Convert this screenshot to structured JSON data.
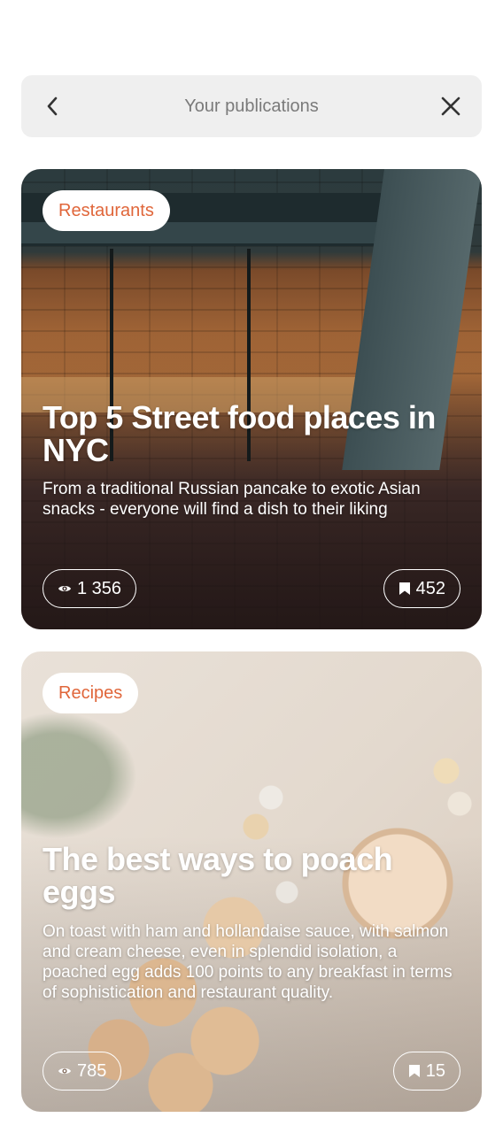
{
  "header": {
    "title": "Your publications",
    "back_icon": "chevron-left-icon",
    "close_icon": "close-icon"
  },
  "colors": {
    "accent": "#e0663a",
    "header_bg": "#efefef",
    "header_text": "#7a7a7a"
  },
  "publications": [
    {
      "category": "Restaurants",
      "title": "Top 5 Street food places in NYC",
      "description": "From a traditional Russian pancake to exotic Asian snacks - everyone will find a dish to their liking",
      "views": "1 356",
      "saves": "452"
    },
    {
      "category": "Recipes",
      "title": "The best ways to poach eggs",
      "description": "On toast with ham and hollandaise sauce, with salmon and cream cheese, even in splendid isolation, a poached egg adds 100 points to any breakfast in terms of sophistication and restaurant quality.",
      "views": "785",
      "saves": "15"
    }
  ]
}
